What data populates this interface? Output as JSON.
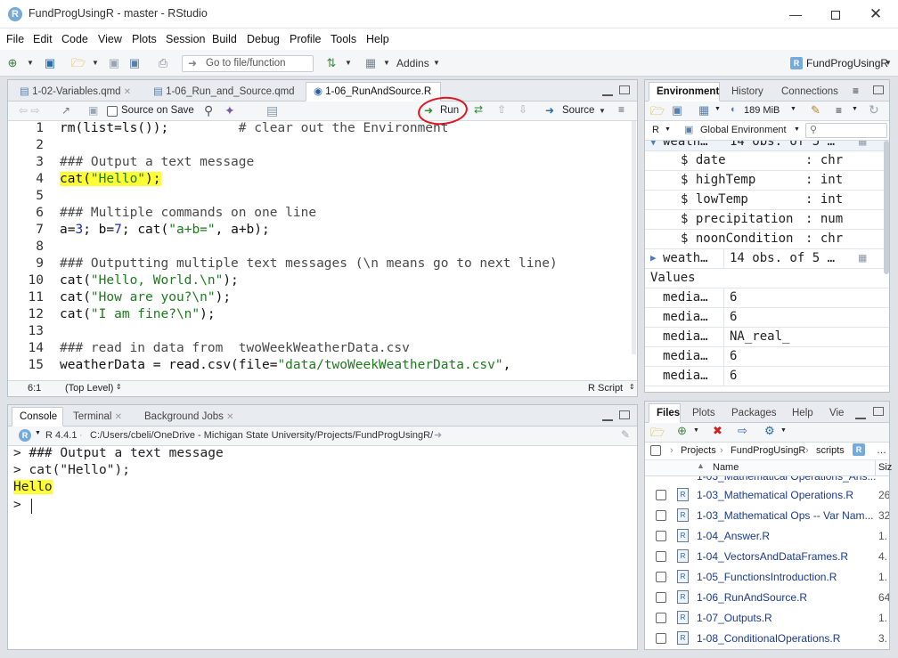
{
  "window": {
    "title": "FundProgUsingR - master - RStudio",
    "app_icon": "R"
  },
  "menu": [
    "File",
    "Edit",
    "Code",
    "View",
    "Plots",
    "Session",
    "Build",
    "Debug",
    "Profile",
    "Tools",
    "Help"
  ],
  "toolbar": {
    "goto_placeholder": "Go to file/function",
    "addins_label": "Addins",
    "project_label": "FundProgUsingR"
  },
  "editor": {
    "tabs": [
      {
        "label": "1-02-Variables.qmd"
      },
      {
        "label": "1-06_Run_and_Source.qmd"
      },
      {
        "label": "1-06_RunAndSource.R"
      }
    ],
    "source_on_save_label": "Source on Save",
    "run_label": "Run",
    "source_label": "Source",
    "lines": [
      "1",
      "2",
      "3",
      "4",
      "5",
      "6",
      "7",
      "8",
      "9",
      "10",
      "11",
      "12",
      "13",
      "14",
      "15"
    ],
    "code": {
      "l1a": "rm(list=ls());",
      "l1b": "# clear out the Environment",
      "l3": "### Output a text message",
      "l4a": "cat(",
      "l4b": "\"Hello\"",
      "l4c": ");",
      "l6": "### Multiple commands on one line",
      "l7a": "a=",
      "l7b": "3",
      "l7c": "; b=",
      "l7d": "7",
      "l7e": "; cat(",
      "l7f": "\"a+b=\"",
      "l7g": ", a+b);",
      "l9": "### Outputting multiple text messages (\\n means go to next line)",
      "l10a": "cat(",
      "l10b": "\"Hello, World.\\n\"",
      "l10c": ");",
      "l11a": "cat(",
      "l11b": "\"How are you?\\n\"",
      "l11c": ");",
      "l12a": "cat(",
      "l12b": "\"I am fine?\\n\"",
      "l12c": ");",
      "l14": "### read in data from  twoWeekWeatherData.csv",
      "l15a": "weatherData = read.csv(file=",
      "l15b": "\"data/twoWeekWeatherData.csv\"",
      "l15c": ","
    },
    "status": {
      "position": "6:1",
      "scope": "(Top Level)",
      "filetype": "R Script"
    }
  },
  "console": {
    "tabs": [
      "Console",
      "Terminal",
      "Background Jobs"
    ],
    "r_version": "R 4.4.1",
    "path": "C:/Users/cbeli/OneDrive - Michigan State University/Projects/FundProgUsingR/",
    "lines": [
      "> ### Output a text message",
      "> cat(\"Hello\");",
      "Hello",
      ">"
    ]
  },
  "environment": {
    "tabs": [
      "Environment",
      "History",
      "Connections"
    ],
    "memory": "189 MiB",
    "lang": "R",
    "scope": "Global Environment",
    "rows": [
      {
        "name": "weath…",
        "value": "14 obs. of 5 …"
      },
      {
        "name": "$ date",
        "value": ": chr"
      },
      {
        "name": "$ highTemp",
        "value": ": int"
      },
      {
        "name": "$ lowTemp",
        "value": ": int"
      },
      {
        "name": "$ precipitation",
        "value": ": num"
      },
      {
        "name": "$ noonCondition",
        "value": ": chr"
      },
      {
        "name": "weath…",
        "value": "14 obs. of 5 …"
      }
    ],
    "values_header": "Values",
    "values": [
      {
        "name": "media…",
        "value": "6"
      },
      {
        "name": "media…",
        "value": "6"
      },
      {
        "name": "media…",
        "value": "NA_real_"
      },
      {
        "name": "media…",
        "value": "6"
      },
      {
        "name": "media…",
        "value": "6"
      }
    ]
  },
  "files": {
    "tabs": [
      "Files",
      "Plots",
      "Packages",
      "Help",
      "Vie"
    ],
    "breadcrumb": [
      "Projects",
      "FundProgUsingR",
      "scripts"
    ],
    "col_name": "Name",
    "col_size": "Siz",
    "rows": [
      {
        "name": "1-03_Mathematical Operations.R",
        "size": "26"
      },
      {
        "name": "1-03_Mathematical Ops -- Var Nam...",
        "size": "32"
      },
      {
        "name": "1-04_Answer.R",
        "size": "1."
      },
      {
        "name": "1-04_VectorsAndDataFrames.R",
        "size": "4."
      },
      {
        "name": "1-05_FunctionsIntroduction.R",
        "size": "1."
      },
      {
        "name": "1-06_RunAndSource.R",
        "size": "64"
      },
      {
        "name": "1-07_Outputs.R",
        "size": "1."
      },
      {
        "name": "1-08_ConditionalOperations.R",
        "size": "3."
      }
    ]
  },
  "colors": {
    "highlight": "#ffff33",
    "annotation": "#e0141e",
    "r_blue": "#75aadb"
  }
}
